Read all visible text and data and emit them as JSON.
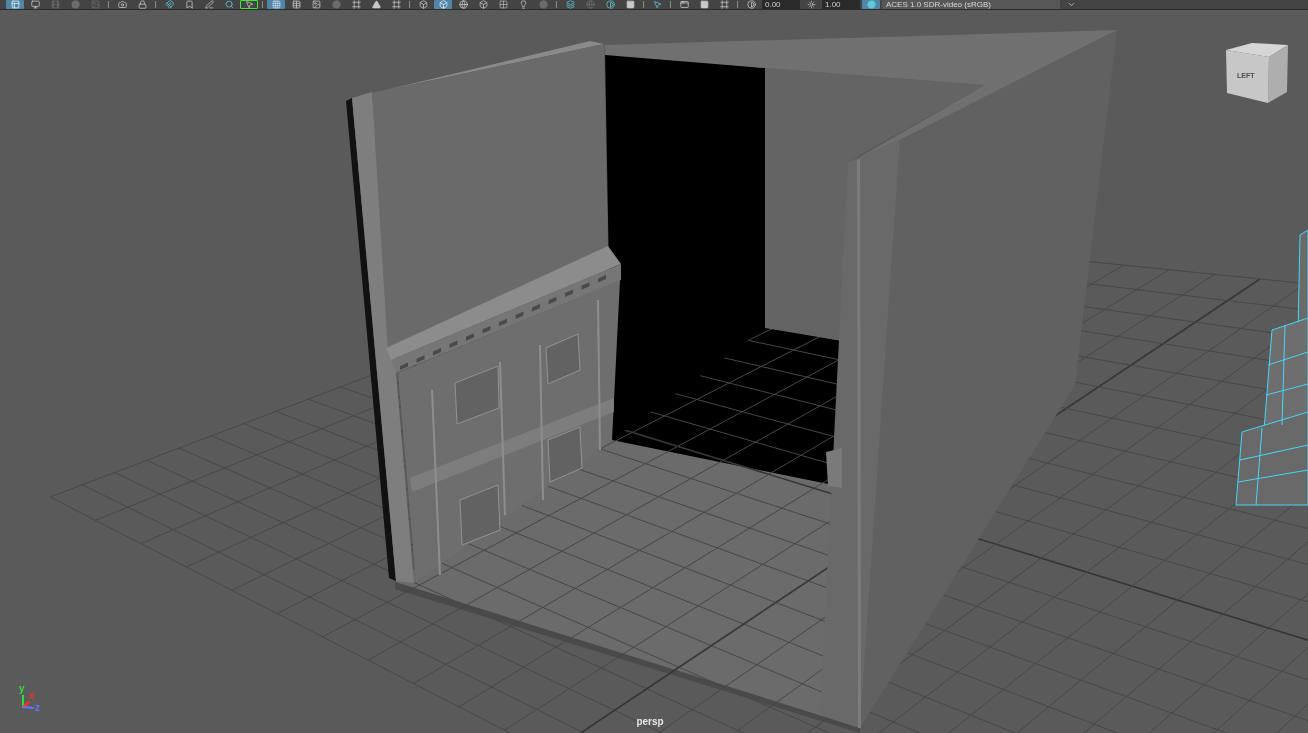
{
  "toolbar": {
    "groups": [
      [
        {
          "kind": "button",
          "on": true,
          "disabled": false,
          "framed": false
        },
        {
          "kind": "button",
          "on": false,
          "disabled": false,
          "framed": false
        },
        {
          "kind": "button",
          "on": false,
          "disabled": true,
          "framed": false
        },
        {
          "kind": "button",
          "on": false,
          "disabled": true,
          "framed": false
        },
        {
          "kind": "button",
          "on": false,
          "disabled": true,
          "framed": false
        }
      ],
      [
        {
          "kind": "button",
          "on": false,
          "disabled": false,
          "framed": false
        },
        {
          "kind": "button",
          "on": false,
          "disabled": false,
          "framed": false
        }
      ],
      [
        {
          "kind": "button",
          "on": false,
          "disabled": false,
          "framed": false
        },
        {
          "kind": "button",
          "on": false,
          "disabled": false,
          "framed": false
        },
        {
          "kind": "button",
          "on": false,
          "disabled": false,
          "framed": false
        },
        {
          "kind": "button",
          "on": false,
          "disabled": false,
          "framed": false
        },
        {
          "kind": "button",
          "on": false,
          "disabled": false,
          "framed": true
        }
      ],
      [
        {
          "kind": "button",
          "on": true,
          "disabled": false,
          "framed": false
        },
        {
          "kind": "button",
          "on": false,
          "disabled": false,
          "framed": false
        },
        {
          "kind": "button",
          "on": false,
          "disabled": false,
          "framed": false
        },
        {
          "kind": "button",
          "on": false,
          "disabled": true,
          "framed": false
        },
        {
          "kind": "button",
          "on": false,
          "disabled": false,
          "framed": false
        },
        {
          "kind": "button",
          "on": false,
          "disabled": false,
          "framed": false
        },
        {
          "kind": "button",
          "on": false,
          "disabled": false,
          "framed": false
        }
      ],
      [
        {
          "kind": "button",
          "on": false,
          "disabled": false,
          "framed": false
        },
        {
          "kind": "button",
          "on": true,
          "disabled": false,
          "framed": false
        },
        {
          "kind": "button",
          "on": false,
          "disabled": false,
          "framed": false
        },
        {
          "kind": "button",
          "on": false,
          "disabled": false,
          "framed": false
        },
        {
          "kind": "button",
          "on": false,
          "disabled": false,
          "framed": false
        },
        {
          "kind": "button",
          "on": false,
          "disabled": false,
          "framed": false
        },
        {
          "kind": "button",
          "on": false,
          "disabled": true,
          "framed": false
        }
      ],
      [
        {
          "kind": "button",
          "on": false,
          "disabled": false,
          "framed": false
        },
        {
          "kind": "button",
          "on": false,
          "disabled": true,
          "framed": false
        },
        {
          "kind": "button",
          "on": false,
          "disabled": false,
          "framed": false
        },
        {
          "kind": "button",
          "on": false,
          "disabled": false,
          "framed": false
        }
      ],
      [
        {
          "kind": "button",
          "on": false,
          "disabled": false,
          "framed": false
        }
      ],
      [
        {
          "kind": "button",
          "on": false,
          "disabled": false,
          "framed": false
        },
        {
          "kind": "button",
          "on": false,
          "disabled": false,
          "framed": false
        },
        {
          "kind": "button",
          "on": false,
          "disabled": false,
          "framed": false
        }
      ],
      [
        {
          "kind": "button",
          "on": false,
          "disabled": false,
          "framed": false
        },
        {
          "kind": "field",
          "value": "0.00"
        },
        {
          "kind": "button",
          "on": false,
          "disabled": false,
          "framed": false
        },
        {
          "kind": "field",
          "value": "1.00"
        },
        {
          "kind": "button",
          "on": true,
          "disabled": false,
          "framed": false
        },
        {
          "kind": "dropdown",
          "value": "ACES 1.0 SDR-video (sRGB)"
        },
        {
          "kind": "button",
          "on": false,
          "disabled": false,
          "framed": false
        }
      ]
    ]
  },
  "viewport": {
    "view_cube": {
      "face_label": "LEFT"
    },
    "axes": [
      {
        "label": "y",
        "color": "#33dd33"
      },
      {
        "label": "x",
        "color": "#ee3333"
      },
      {
        "label": "z",
        "color": "#6677ff"
      }
    ],
    "camera_label": "persp"
  }
}
